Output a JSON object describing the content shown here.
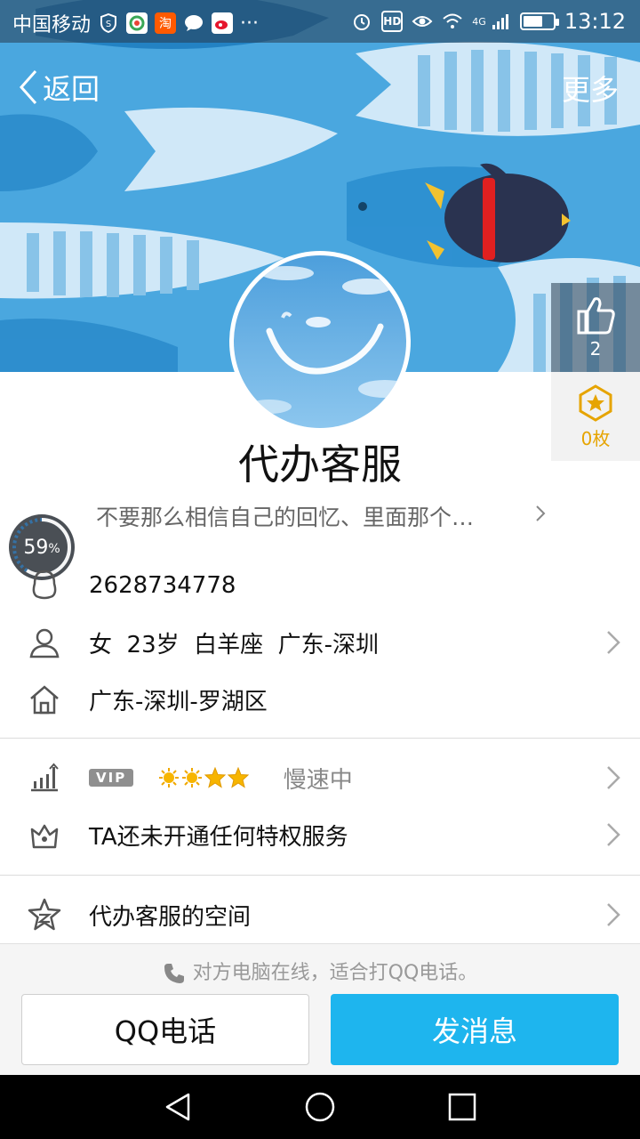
{
  "statusbar": {
    "carrier": "中国移动",
    "more": "···",
    "hd": "HD",
    "network": "4G",
    "time": "13:12"
  },
  "nav": {
    "back_label": "返回",
    "more_label": "更多"
  },
  "side": {
    "likes": "2",
    "medals": "0枚"
  },
  "profile": {
    "nickname": "代办客服",
    "signature": "不要那么相信自己的回忆、里面那个…",
    "progress_text": "59",
    "progress_unit": "%",
    "progress_value": 0.59
  },
  "info": {
    "qq_number": "2628734778",
    "basic": "女  23岁  白羊座  广东-深圳",
    "location": "广东-深圳-罗湖区",
    "vip_badge": "VIP",
    "level_status": "慢速中",
    "privilege": "TA还未开通任何特权服务",
    "space": "代办客服的空间"
  },
  "bottom": {
    "hint": "对方电脑在线，适合打QQ电话。",
    "call_button": "QQ电话",
    "message_button": "发消息"
  },
  "colors": {
    "primary_blue": "#1eb5ee",
    "medal_gold": "#e6a400",
    "banner_blue": "#4aa7df"
  }
}
